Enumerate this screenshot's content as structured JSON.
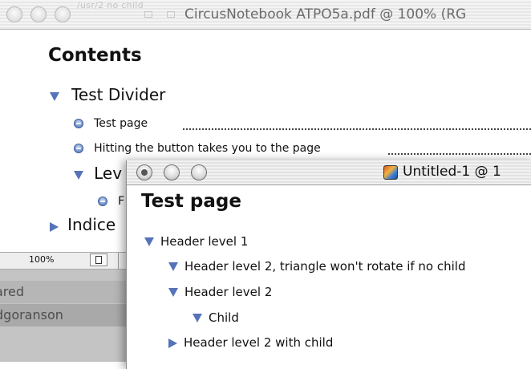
{
  "back_window": {
    "title": "CircusNotebook ATPO5a.pdf @ 100% (RG",
    "ghost_title": "/usr/2 no child",
    "contents_heading": "Contents",
    "toc": {
      "divider_label": "Test Divider",
      "item_test_page": "Test page",
      "item_hitting": "Hitting the button takes you to the page",
      "partial_level": "Lev",
      "partial_f": "F",
      "partial_indices": "Indice"
    },
    "statusbar": {
      "zoom": "100%"
    },
    "panel": {
      "row_shared": "ared",
      "row_user": "dgoranson"
    }
  },
  "front_window": {
    "title": "Untitled-1 @ 1",
    "heading": "Test page",
    "outline": [
      {
        "label": "Header level 1",
        "state": "expanded"
      },
      {
        "label": "Header level 2, triangle won't rotate if no child",
        "state": "expanded"
      },
      {
        "label": "Header level 2",
        "state": "expanded"
      },
      {
        "label": "Child",
        "state": "expanded"
      },
      {
        "label": "Header level 2 with child",
        "state": "collapsed"
      }
    ]
  },
  "colors": {
    "triangle": "#5573b8",
    "bullet": "#4d6fb3",
    "panel_gray": "#c4c4c4"
  },
  "icons": [
    "disclosure-triangle-icon",
    "bullet-disc-icon",
    "page-icon",
    "document-proxy-icon",
    "close-button-icon"
  ]
}
